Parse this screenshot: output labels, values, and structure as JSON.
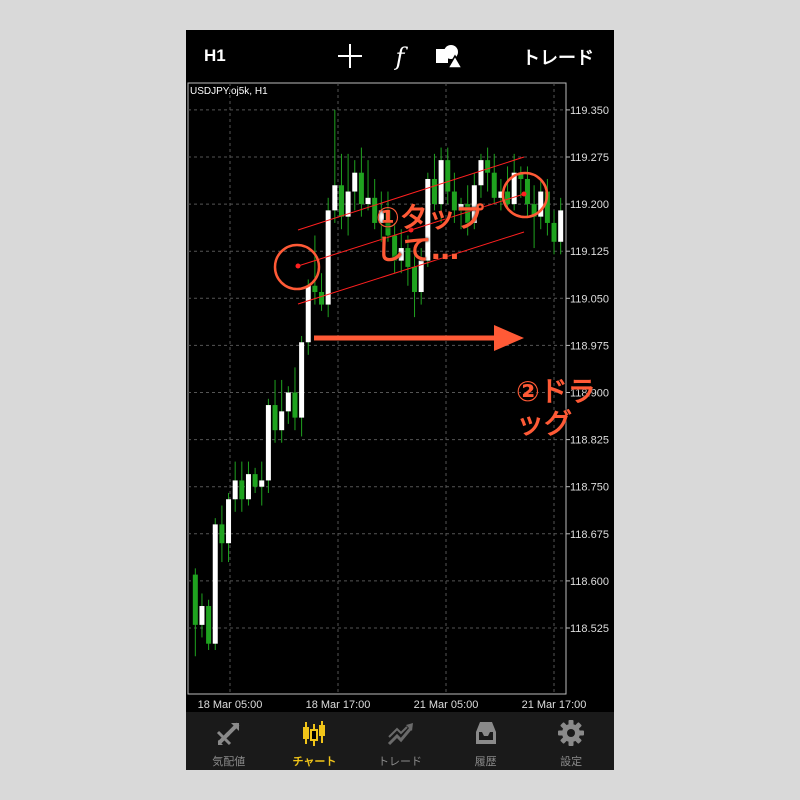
{
  "toolbar": {
    "timeframe": "H1",
    "crosshair_icon": "crosshair-icon",
    "indicator_icon": "function-icon",
    "objects_icon": "shapes-icon",
    "trade_label": "トレード"
  },
  "chart": {
    "symbol_label": "USDJPY.oj5k, H1",
    "price_ticks": [
      "119.350",
      "119.275",
      "119.200",
      "119.125",
      "119.050",
      "118.975",
      "118.900",
      "118.825",
      "118.750",
      "118.675",
      "118.600",
      "118.525"
    ],
    "time_ticks": [
      "18 Mar 05:00",
      "18 Mar 17:00",
      "21 Mar 05:00",
      "21 Mar 17:00"
    ],
    "colors": {
      "bull": "#ffffff",
      "bear": "#1fa31f",
      "wick": "#1fa31f",
      "channel": "#ff2020",
      "grid": "#555555"
    },
    "candles": [
      [
        118.61,
        118.62,
        118.48,
        118.53
      ],
      [
        118.53,
        118.58,
        118.51,
        118.56
      ],
      [
        118.56,
        118.57,
        118.49,
        118.5
      ],
      [
        118.5,
        118.7,
        118.49,
        118.69
      ],
      [
        118.69,
        118.72,
        118.63,
        118.66
      ],
      [
        118.66,
        118.74,
        118.63,
        118.73
      ],
      [
        118.73,
        118.79,
        118.71,
        118.76
      ],
      [
        118.76,
        118.79,
        118.71,
        118.73
      ],
      [
        118.73,
        118.79,
        118.72,
        118.77
      ],
      [
        118.77,
        118.78,
        118.74,
        118.75
      ],
      [
        118.75,
        118.79,
        118.72,
        118.76
      ],
      [
        118.76,
        118.89,
        118.74,
        118.88
      ],
      [
        118.88,
        118.92,
        118.82,
        118.84
      ],
      [
        118.84,
        118.92,
        118.82,
        118.87
      ],
      [
        118.87,
        118.91,
        118.85,
        118.9
      ],
      [
        118.9,
        118.94,
        118.84,
        118.86
      ],
      [
        118.86,
        118.99,
        118.83,
        118.98
      ],
      [
        118.98,
        119.08,
        118.96,
        119.07
      ],
      [
        119.07,
        119.15,
        119.04,
        119.06
      ],
      [
        119.06,
        119.09,
        119.03,
        119.04
      ],
      [
        119.04,
        119.21,
        119.02,
        119.19
      ],
      [
        119.19,
        119.35,
        119.17,
        119.23
      ],
      [
        119.23,
        119.28,
        119.16,
        119.18
      ],
      [
        119.18,
        119.28,
        119.15,
        119.22
      ],
      [
        119.22,
        119.27,
        119.19,
        119.25
      ],
      [
        119.25,
        119.29,
        119.18,
        119.2
      ],
      [
        119.2,
        119.27,
        119.19,
        119.21
      ],
      [
        119.21,
        119.24,
        119.16,
        119.17
      ],
      [
        119.17,
        119.22,
        119.14,
        119.19
      ],
      [
        119.19,
        119.22,
        119.14,
        119.15
      ],
      [
        119.15,
        119.17,
        119.09,
        119.11
      ],
      [
        119.11,
        119.16,
        119.09,
        119.13
      ],
      [
        119.13,
        119.15,
        119.07,
        119.1
      ],
      [
        119.1,
        119.12,
        119.02,
        119.06
      ],
      [
        119.06,
        119.13,
        119.04,
        119.11
      ],
      [
        119.11,
        119.25,
        119.1,
        119.24
      ],
      [
        119.24,
        119.28,
        119.19,
        119.2
      ],
      [
        119.2,
        119.29,
        119.17,
        119.27
      ],
      [
        119.27,
        119.29,
        119.2,
        119.22
      ],
      [
        119.22,
        119.25,
        119.17,
        119.19
      ],
      [
        119.19,
        119.21,
        119.16,
        119.2
      ],
      [
        119.2,
        119.23,
        119.15,
        119.17
      ],
      [
        119.17,
        119.25,
        119.16,
        119.23
      ],
      [
        119.23,
        119.28,
        119.21,
        119.27
      ],
      [
        119.27,
        119.29,
        119.22,
        119.25
      ],
      [
        119.25,
        119.28,
        119.2,
        119.21
      ],
      [
        119.21,
        119.24,
        119.19,
        119.22
      ],
      [
        119.22,
        119.26,
        119.19,
        119.2
      ],
      [
        119.2,
        119.28,
        119.19,
        119.25
      ],
      [
        119.25,
        119.26,
        119.21,
        119.24
      ],
      [
        119.24,
        119.26,
        119.18,
        119.2
      ],
      [
        119.2,
        119.23,
        119.13,
        119.18
      ],
      [
        119.18,
        119.24,
        119.16,
        119.22
      ],
      [
        119.22,
        119.24,
        119.15,
        119.17
      ],
      [
        119.17,
        119.19,
        119.12,
        119.14
      ],
      [
        119.14,
        119.21,
        119.12,
        119.19
      ]
    ]
  },
  "annotations": {
    "step1_line1": "①タップ",
    "step1_line2": "して…",
    "step2": "②ドラッグ"
  },
  "nav": {
    "items": [
      {
        "label": "気配値",
        "icon": "quotes-icon"
      },
      {
        "label": "チャート",
        "icon": "candlestick-icon"
      },
      {
        "label": "トレード",
        "icon": "trade-icon"
      },
      {
        "label": "履歴",
        "icon": "history-icon"
      },
      {
        "label": "設定",
        "icon": "gear-icon"
      }
    ]
  }
}
